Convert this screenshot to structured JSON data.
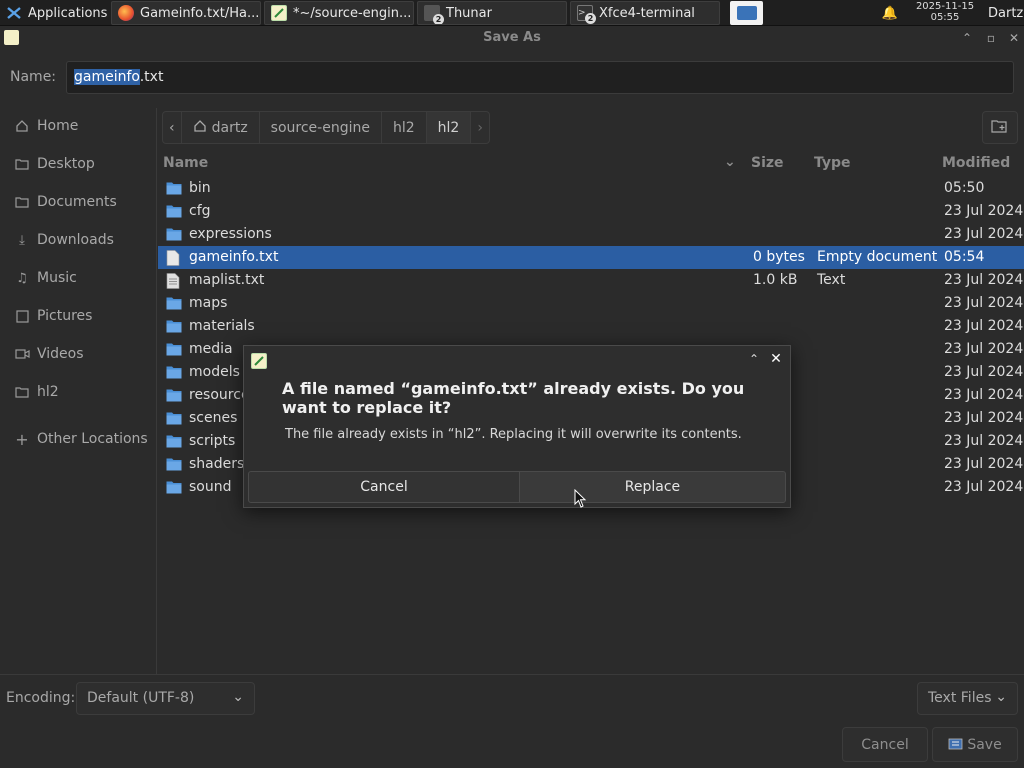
{
  "taskbar": {
    "applications_label": "Applications",
    "windows": [
      {
        "label": "Gameinfo.txt/Ha...",
        "icon": "firefox-icon"
      },
      {
        "label": "*~/source-engin...",
        "icon": "text-editor-icon"
      },
      {
        "label": "Thunar",
        "icon": "file-manager-icon",
        "badge": "2"
      },
      {
        "label": "Xfce4-terminal",
        "icon": "terminal-icon",
        "badge": "2"
      }
    ],
    "clock_date": "2025-11-15",
    "clock_time": "05:55",
    "user": "Dartz"
  },
  "window": {
    "title": "Save As"
  },
  "name_row": {
    "label": "Name:",
    "value_selected": "gameinfo",
    "value_rest": ".txt"
  },
  "sidebar": {
    "items": [
      {
        "label": "Home",
        "icon": "home-icon"
      },
      {
        "label": "Desktop",
        "icon": "folder-icon"
      },
      {
        "label": "Documents",
        "icon": "folder-icon"
      },
      {
        "label": "Downloads",
        "icon": "download-icon"
      },
      {
        "label": "Music",
        "icon": "music-icon"
      },
      {
        "label": "Pictures",
        "icon": "pictures-icon"
      },
      {
        "label": "Videos",
        "icon": "video-icon"
      },
      {
        "label": "hl2",
        "icon": "folder-icon"
      },
      {
        "label": "Other Locations",
        "icon": "plus-icon"
      }
    ]
  },
  "pathbar": {
    "segments": [
      "dartz",
      "source-engine",
      "hl2",
      "hl2"
    ]
  },
  "columns": {
    "name": "Name",
    "size": "Size",
    "type": "Type",
    "modified": "Modified"
  },
  "files": [
    {
      "name": "bin",
      "size": "",
      "type": "",
      "modified": "05:50",
      "kind": "folder"
    },
    {
      "name": "cfg",
      "size": "",
      "type": "",
      "modified": "23 Jul 2024",
      "kind": "folder"
    },
    {
      "name": "expressions",
      "size": "",
      "type": "",
      "modified": "23 Jul 2024",
      "kind": "folder"
    },
    {
      "name": "gameinfo.txt",
      "size": "0 bytes",
      "type": "Empty document",
      "modified": "05:54",
      "kind": "file",
      "selected": true
    },
    {
      "name": "maplist.txt",
      "size": "1.0 kB",
      "type": "Text",
      "modified": "23 Jul 2024",
      "kind": "text"
    },
    {
      "name": "maps",
      "size": "",
      "type": "",
      "modified": "23 Jul 2024",
      "kind": "folder"
    },
    {
      "name": "materials",
      "size": "",
      "type": "",
      "modified": "23 Jul 2024",
      "kind": "folder"
    },
    {
      "name": "media",
      "size": "",
      "type": "",
      "modified": "23 Jul 2024",
      "kind": "folder"
    },
    {
      "name": "models",
      "size": "",
      "type": "",
      "modified": "23 Jul 2024",
      "kind": "folder"
    },
    {
      "name": "resource",
      "size": "",
      "type": "",
      "modified": "23 Jul 2024",
      "kind": "folder"
    },
    {
      "name": "scenes",
      "size": "",
      "type": "",
      "modified": "23 Jul 2024",
      "kind": "folder"
    },
    {
      "name": "scripts",
      "size": "",
      "type": "",
      "modified": "23 Jul 2024",
      "kind": "folder"
    },
    {
      "name": "shaders",
      "size": "",
      "type": "",
      "modified": "23 Jul 2024",
      "kind": "folder"
    },
    {
      "name": "sound",
      "size": "",
      "type": "",
      "modified": "23 Jul 2024",
      "kind": "folder"
    }
  ],
  "bottom": {
    "encoding_label": "Encoding:",
    "encoding_value": "Default (UTF-8)",
    "filter_value": "Text Files",
    "cancel_label": "Cancel",
    "save_label": "Save"
  },
  "dialog": {
    "title": "A file named “gameinfo.txt” already exists.  Do you want to replace it?",
    "message": "The file already exists in “hl2”.  Replacing it will overwrite its contents.",
    "cancel_label": "Cancel",
    "replace_label": "Replace"
  },
  "colors": {
    "selection": "#2b5ea3",
    "folder": "#4a8fd6",
    "background": "#2b2b2b"
  }
}
